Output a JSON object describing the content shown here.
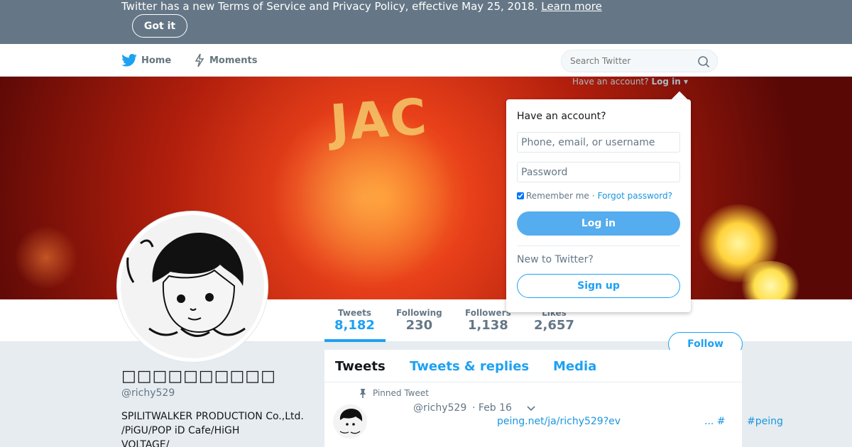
{
  "banner": {
    "text": "Twitter has a new Terms of Service and Privacy Policy, effective May 25, 2018.",
    "link": "Learn more",
    "button": "Got it"
  },
  "nav": {
    "home": "Home",
    "moments": "Moments",
    "search_placeholder": "Search Twitter",
    "have_account": "Have an account?",
    "login_link": "Log in ▾",
    "brand_color": "#1da1f2"
  },
  "header": {
    "image_text": "JAC"
  },
  "login": {
    "title": "Have an account?",
    "username_placeholder": "Phone, email, or username",
    "password_placeholder": "Password",
    "remember": "Remember me",
    "sep": "·",
    "forgot": "Forgot password?",
    "login_button": "Log in",
    "new_to": "New to Twitter?",
    "signup_button": "Sign up"
  },
  "stats": [
    {
      "label": "Tweets",
      "value": "8,182"
    },
    {
      "label": "Following",
      "value": "230"
    },
    {
      "label": "Followers",
      "value": "1,138"
    },
    {
      "label": "Likes",
      "value": "2,657"
    }
  ],
  "follow_button": "Follow",
  "profile": {
    "name": "□□□□□□□□□□",
    "handle": "@richy529",
    "bio_lines": [
      "SPILITWALKER PRODUCTION Co.,Ltd.",
      "/PiGU/POP iD Cafe/HiGH",
      "VOLTAGE/"
    ]
  },
  "timeline": {
    "tabs": [
      "Tweets",
      "Tweets & replies",
      "Media"
    ],
    "pinned_label": "Pinned Tweet",
    "tweet": {
      "handle": "@richy529",
      "date": "· Feb 16",
      "link": "peing.net/ja/richy529?ev",
      "hash1": "... #",
      "hash2": "#peing"
    }
  }
}
